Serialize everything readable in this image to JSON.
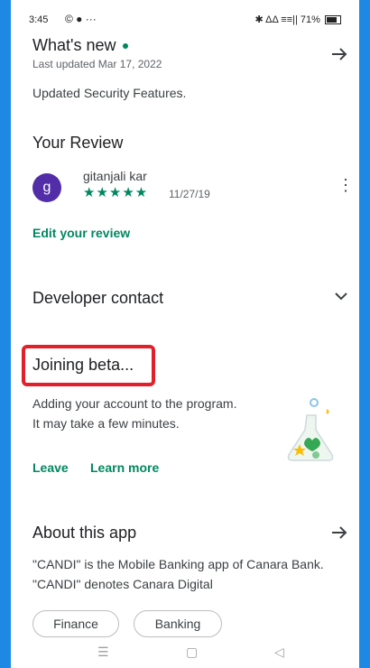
{
  "status_bar": {
    "time": "3:45",
    "left_icons": "© ● ···",
    "right_text": "✱ ΔΔ ≡≡|| 71%"
  },
  "whats_new": {
    "title": "What's new",
    "updated": "Last updated Mar 17, 2022",
    "body": "Updated Security Features."
  },
  "your_review": {
    "title": "Your Review",
    "avatar_letter": "g",
    "reviewer_name": "gitanjali kar",
    "stars": "★★★★★",
    "rating": 5,
    "date": "11/27/19",
    "edit_label": "Edit your review"
  },
  "developer_contact": {
    "title": "Developer contact"
  },
  "beta": {
    "title": "Joining beta...",
    "body": "Adding your account to the program. It may take a few minutes.",
    "leave_label": "Leave",
    "learn_more_label": "Learn more"
  },
  "about": {
    "title": "About this app",
    "body": "\"CANDI\" is the Mobile Banking app of Canara Bank. \"CANDI\" denotes Canara Digital"
  },
  "chips": [
    "Finance",
    "Banking"
  ],
  "nav": {
    "menu": "☰",
    "home": "▢",
    "back": "◁"
  },
  "colors": {
    "accent_green": "#01875f",
    "avatar_purple": "#512da8",
    "highlight_red": "#e2202a",
    "frame_blue": "#1e88e5"
  }
}
